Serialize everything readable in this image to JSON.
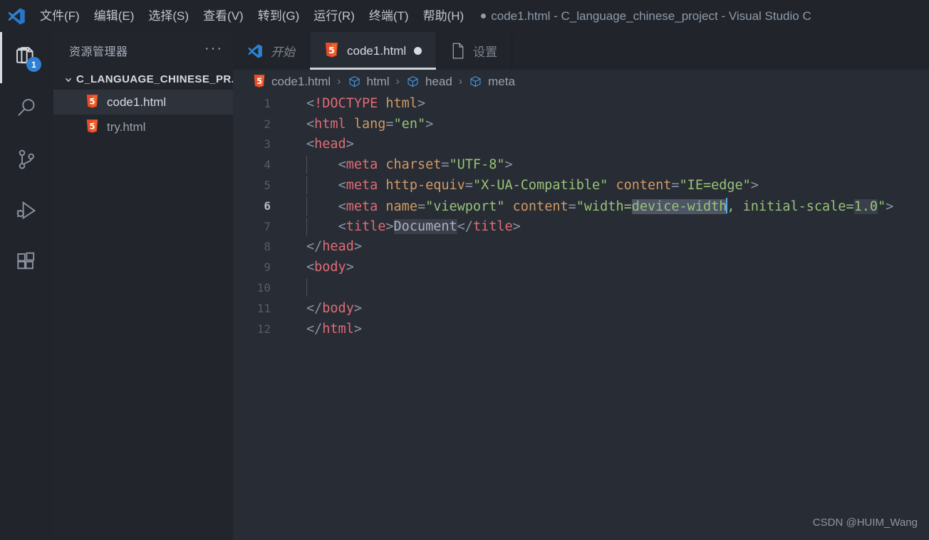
{
  "window": {
    "title_prefix_dot": "●",
    "title": "code1.html - C_language_chinese_project - Visual Studio C",
    "logo_icon": "vscode-logo-icon"
  },
  "menubar": {
    "items": [
      {
        "label": "文件(F)"
      },
      {
        "label": "编辑(E)"
      },
      {
        "label": "选择(S)"
      },
      {
        "label": "查看(V)"
      },
      {
        "label": "转到(G)"
      },
      {
        "label": "运行(R)"
      },
      {
        "label": "终端(T)"
      },
      {
        "label": "帮助(H)"
      }
    ]
  },
  "activitybar": {
    "items": [
      {
        "name": "explorer",
        "icon": "files-icon",
        "badge": "1",
        "active": true
      },
      {
        "name": "search",
        "icon": "search-icon",
        "badge": "",
        "active": false
      },
      {
        "name": "source-control",
        "icon": "source-control-icon",
        "badge": "",
        "active": false
      },
      {
        "name": "run-debug",
        "icon": "run-and-debug-icon",
        "badge": "",
        "active": false
      },
      {
        "name": "extensions",
        "icon": "extensions-icon",
        "badge": "",
        "active": false
      }
    ]
  },
  "sidebar": {
    "title": "资源管理器",
    "more_actions": "···",
    "root_folder": "C_LANGUAGE_CHINESE_PR...",
    "files": [
      {
        "name": "code1.html",
        "icon": "html5-icon",
        "selected": true
      },
      {
        "name": "try.html",
        "icon": "html5-icon",
        "selected": false
      }
    ]
  },
  "tabs": [
    {
      "label": "开始",
      "icon": "vscode-logo-icon",
      "italic": true,
      "active": false,
      "dirty": false
    },
    {
      "label": "code1.html",
      "icon": "html5-icon",
      "italic": false,
      "active": true,
      "dirty": true
    },
    {
      "label": "设置",
      "icon": "file-icon",
      "italic": false,
      "active": false,
      "dirty": false
    }
  ],
  "breadcrumb": [
    {
      "label": "code1.html",
      "icon": "html5-icon"
    },
    {
      "label": "html",
      "icon": "symbol-cube-icon"
    },
    {
      "label": "head",
      "icon": "symbol-cube-icon"
    },
    {
      "label": "meta",
      "icon": "symbol-cube-icon"
    }
  ],
  "editor": {
    "current_line": 6,
    "lines": [
      {
        "n": "1",
        "indent": false,
        "tokens": [
          {
            "t": "punc",
            "v": "<"
          },
          {
            "t": "tag",
            "v": "!DOCTYPE"
          },
          {
            "t": "txt",
            "v": " "
          },
          {
            "t": "attr",
            "v": "html"
          },
          {
            "t": "punc",
            "v": ">"
          }
        ]
      },
      {
        "n": "2",
        "indent": false,
        "tokens": [
          {
            "t": "punc",
            "v": "<"
          },
          {
            "t": "tag",
            "v": "html"
          },
          {
            "t": "txt",
            "v": " "
          },
          {
            "t": "attr",
            "v": "lang"
          },
          {
            "t": "punc",
            "v": "="
          },
          {
            "t": "str",
            "v": "\"en\""
          },
          {
            "t": "punc",
            "v": ">"
          }
        ]
      },
      {
        "n": "3",
        "indent": false,
        "tokens": [
          {
            "t": "punc",
            "v": "<"
          },
          {
            "t": "tag",
            "v": "head"
          },
          {
            "t": "punc",
            "v": ">"
          }
        ]
      },
      {
        "n": "4",
        "indent": true,
        "tokens": [
          {
            "t": "txt",
            "v": "    "
          },
          {
            "t": "punc",
            "v": "<"
          },
          {
            "t": "tag",
            "v": "meta"
          },
          {
            "t": "txt",
            "v": " "
          },
          {
            "t": "attr",
            "v": "charset"
          },
          {
            "t": "punc",
            "v": "="
          },
          {
            "t": "str",
            "v": "\"UTF-8\""
          },
          {
            "t": "punc",
            "v": ">"
          }
        ]
      },
      {
        "n": "5",
        "indent": true,
        "tokens": [
          {
            "t": "txt",
            "v": "    "
          },
          {
            "t": "punc",
            "v": "<"
          },
          {
            "t": "tag",
            "v": "meta"
          },
          {
            "t": "txt",
            "v": " "
          },
          {
            "t": "attr",
            "v": "http-equiv"
          },
          {
            "t": "punc",
            "v": "="
          },
          {
            "t": "str",
            "v": "\"X-UA-Compatible\""
          },
          {
            "t": "txt",
            "v": " "
          },
          {
            "t": "attr",
            "v": "content"
          },
          {
            "t": "punc",
            "v": "="
          },
          {
            "t": "str",
            "v": "\"IE=edge\""
          },
          {
            "t": "punc",
            "v": ">"
          }
        ]
      },
      {
        "n": "6",
        "indent": true,
        "tokens": [
          {
            "t": "txt",
            "v": "    "
          },
          {
            "t": "punc",
            "v": "<"
          },
          {
            "t": "tag",
            "v": "meta"
          },
          {
            "t": "txt",
            "v": " "
          },
          {
            "t": "attr",
            "v": "name"
          },
          {
            "t": "punc",
            "v": "="
          },
          {
            "t": "str",
            "v": "\"viewport\""
          },
          {
            "t": "txt",
            "v": " "
          },
          {
            "t": "attr",
            "v": "content"
          },
          {
            "t": "punc",
            "v": "="
          },
          {
            "t": "str",
            "v": "\"width="
          },
          {
            "t": "str sel",
            "v": "device-width"
          },
          {
            "t": "caret",
            "v": ""
          },
          {
            "t": "str",
            "v": ", initial-scale="
          },
          {
            "t": "str occ",
            "v": "1.0"
          },
          {
            "t": "str",
            "v": "\""
          },
          {
            "t": "punc",
            "v": ">"
          }
        ]
      },
      {
        "n": "7",
        "indent": true,
        "tokens": [
          {
            "t": "txt",
            "v": "    "
          },
          {
            "t": "punc",
            "v": "<"
          },
          {
            "t": "tag",
            "v": "title"
          },
          {
            "t": "punc",
            "v": ">"
          },
          {
            "t": "txt occ",
            "v": "Document"
          },
          {
            "t": "punc",
            "v": "</"
          },
          {
            "t": "tag",
            "v": "title"
          },
          {
            "t": "punc",
            "v": ">"
          }
        ]
      },
      {
        "n": "8",
        "indent": false,
        "tokens": [
          {
            "t": "punc",
            "v": "</"
          },
          {
            "t": "tag",
            "v": "head"
          },
          {
            "t": "punc",
            "v": ">"
          }
        ]
      },
      {
        "n": "9",
        "indent": false,
        "tokens": [
          {
            "t": "punc",
            "v": "<"
          },
          {
            "t": "tag",
            "v": "body"
          },
          {
            "t": "punc",
            "v": ">"
          }
        ]
      },
      {
        "n": "10",
        "indent": true,
        "tokens": [
          {
            "t": "txt",
            "v": "    "
          }
        ]
      },
      {
        "n": "11",
        "indent": false,
        "tokens": [
          {
            "t": "punc",
            "v": "</"
          },
          {
            "t": "tag",
            "v": "body"
          },
          {
            "t": "punc",
            "v": ">"
          }
        ]
      },
      {
        "n": "12",
        "indent": false,
        "tokens": [
          {
            "t": "punc",
            "v": "</"
          },
          {
            "t": "tag",
            "v": "html"
          },
          {
            "t": "punc",
            "v": ">"
          }
        ]
      }
    ]
  },
  "watermark": "CSDN @HUIM_Wang",
  "colors": {
    "titlebar_bg": "#21252b",
    "sidebar_bg": "#22252b",
    "editor_bg": "#282c34",
    "accent_badge": "#2f7fd4",
    "html5_orange": "#e44d26",
    "tag": "#e06c75",
    "attr": "#d19a66",
    "string": "#98c379",
    "punct": "#8a94a5",
    "selection": "#4e5566"
  }
}
